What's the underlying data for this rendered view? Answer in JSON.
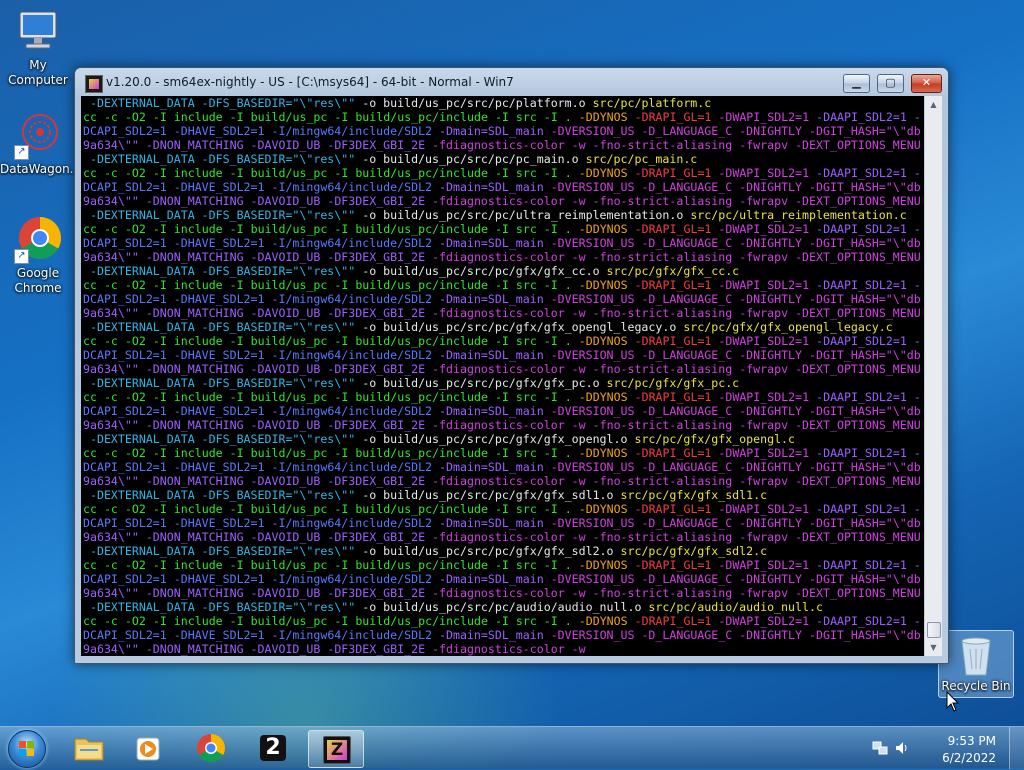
{
  "desktop": {
    "icons": [
      {
        "label": "My Computer"
      },
      {
        "label": "DataWagon..."
      },
      {
        "label": "Google Chrome"
      },
      {
        "label": "Recycle Bin"
      }
    ]
  },
  "window": {
    "title": "v1.20.0 - sm64ex-nightly - US - [C:\\msys64] - 64-bit - Normal - Win7",
    "buttons": {
      "minimize": "▁",
      "maximize": "▢",
      "close": "✕"
    }
  },
  "colors": {
    "green": "#2ee62e",
    "white": "#e8e8e8",
    "cyan": "#2fb5e8",
    "yellow": "#e8e33a",
    "orange": "#f0a020",
    "red": "#ef4040",
    "magenta": "#d040e0",
    "violet": "#9a60ff",
    "blue": "#5a78ff"
  },
  "console": {
    "lines": [
      " -DEXTERNAL_DATA -DFS_BASEDIR=\"\\\"res\\\"\" -o build/us_pc/src/pc/platform.o src/pc/platform.c",
      "cc -c -O2 -I include -I build/us_pc -I build/us_pc/include -I src -I . -DDYNOS -DRAPI_GL=1 -DWAPI_SDL2=1 -DAAPI_SDL2=1 -",
      "DCAPI_SDL2=1 -DHAVE_SDL2=1 -I/mingw64/include/SDL2 -Dmain=SDL_main -DVERSION_US -D_LANGUAGE_C -DNIGHTLY -DGIT_HASH=\"\\\"db",
      "9a634\\\"\" -DNON_MATCHING -DAVOID_UB -DF3DEX_GBI_2E -fdiagnostics-color -w -fno-strict-aliasing -fwrapv -DEXT_OPTIONS_MENU",
      " -DEXTERNAL_DATA -DFS_BASEDIR=\"\\\"res\\\"\" -o build/us_pc/src/pc/pc_main.o src/pc/pc_main.c",
      "cc -c -O2 -I include -I build/us_pc -I build/us_pc/include -I src -I . -DDYNOS -DRAPI_GL=1 -DWAPI_SDL2=1 -DAAPI_SDL2=1 -",
      "DCAPI_SDL2=1 -DHAVE_SDL2=1 -I/mingw64/include/SDL2 -Dmain=SDL_main -DVERSION_US -D_LANGUAGE_C -DNIGHTLY -DGIT_HASH=\"\\\"db",
      "9a634\\\"\" -DNON_MATCHING -DAVOID_UB -DF3DEX_GBI_2E -fdiagnostics-color -w -fno-strict-aliasing -fwrapv -DEXT_OPTIONS_MENU",
      " -DEXTERNAL_DATA -DFS_BASEDIR=\"\\\"res\\\"\" -o build/us_pc/src/pc/ultra_reimplementation.o src/pc/ultra_reimplementation.c",
      "cc -c -O2 -I include -I build/us_pc -I build/us_pc/include -I src -I . -DDYNOS -DRAPI_GL=1 -DWAPI_SDL2=1 -DAAPI_SDL2=1 -",
      "DCAPI_SDL2=1 -DHAVE_SDL2=1 -I/mingw64/include/SDL2 -Dmain=SDL_main -DVERSION_US -D_LANGUAGE_C -DNIGHTLY -DGIT_HASH=\"\\\"db",
      "9a634\\\"\" -DNON_MATCHING -DAVOID_UB -DF3DEX_GBI_2E -fdiagnostics-color -w -fno-strict-aliasing -fwrapv -DEXT_OPTIONS_MENU",
      " -DEXTERNAL_DATA -DFS_BASEDIR=\"\\\"res\\\"\" -o build/us_pc/src/pc/gfx/gfx_cc.o src/pc/gfx/gfx_cc.c",
      "cc -c -O2 -I include -I build/us_pc -I build/us_pc/include -I src -I . -DDYNOS -DRAPI_GL=1 -DWAPI_SDL2=1 -DAAPI_SDL2=1 -",
      "DCAPI_SDL2=1 -DHAVE_SDL2=1 -I/mingw64/include/SDL2 -Dmain=SDL_main -DVERSION_US -D_LANGUAGE_C -DNIGHTLY -DGIT_HASH=\"\\\"db",
      "9a634\\\"\" -DNON_MATCHING -DAVOID_UB -DF3DEX_GBI_2E -fdiagnostics-color -w -fno-strict-aliasing -fwrapv -DEXT_OPTIONS_MENU",
      " -DEXTERNAL_DATA -DFS_BASEDIR=\"\\\"res\\\"\" -o build/us_pc/src/pc/gfx/gfx_opengl_legacy.o src/pc/gfx/gfx_opengl_legacy.c",
      "cc -c -O2 -I include -I build/us_pc -I build/us_pc/include -I src -I . -DDYNOS -DRAPI_GL=1 -DWAPI_SDL2=1 -DAAPI_SDL2=1 -",
      "DCAPI_SDL2=1 -DHAVE_SDL2=1 -I/mingw64/include/SDL2 -Dmain=SDL_main -DVERSION_US -D_LANGUAGE_C -DNIGHTLY -DGIT_HASH=\"\\\"db",
      "9a634\\\"\" -DNON_MATCHING -DAVOID_UB -DF3DEX_GBI_2E -fdiagnostics-color -w -fno-strict-aliasing -fwrapv -DEXT_OPTIONS_MENU",
      " -DEXTERNAL_DATA -DFS_BASEDIR=\"\\\"res\\\"\" -o build/us_pc/src/pc/gfx/gfx_pc.o src/pc/gfx/gfx_pc.c",
      "cc -c -O2 -I include -I build/us_pc -I build/us_pc/include -I src -I . -DDYNOS -DRAPI_GL=1 -DWAPI_SDL2=1 -DAAPI_SDL2=1 -",
      "DCAPI_SDL2=1 -DHAVE_SDL2=1 -I/mingw64/include/SDL2 -Dmain=SDL_main -DVERSION_US -D_LANGUAGE_C -DNIGHTLY -DGIT_HASH=\"\\\"db",
      "9a634\\\"\" -DNON_MATCHING -DAVOID_UB -DF3DEX_GBI_2E -fdiagnostics-color -w -fno-strict-aliasing -fwrapv -DEXT_OPTIONS_MENU",
      " -DEXTERNAL_DATA -DFS_BASEDIR=\"\\\"res\\\"\" -o build/us_pc/src/pc/gfx/gfx_opengl.o src/pc/gfx/gfx_opengl.c",
      "cc -c -O2 -I include -I build/us_pc -I build/us_pc/include -I src -I . -DDYNOS -DRAPI_GL=1 -DWAPI_SDL2=1 -DAAPI_SDL2=1 -",
      "DCAPI_SDL2=1 -DHAVE_SDL2=1 -I/mingw64/include/SDL2 -Dmain=SDL_main -DVERSION_US -D_LANGUAGE_C -DNIGHTLY -DGIT_HASH=\"\\\"db",
      "9a634\\\"\" -DNON_MATCHING -DAVOID_UB -DF3DEX_GBI_2E -fdiagnostics-color -w -fno-strict-aliasing -fwrapv -DEXT_OPTIONS_MENU",
      " -DEXTERNAL_DATA -DFS_BASEDIR=\"\\\"res\\\"\" -o build/us_pc/src/pc/gfx/gfx_sdl1.o src/pc/gfx/gfx_sdl1.c",
      "cc -c -O2 -I include -I build/us_pc -I build/us_pc/include -I src -I . -DDYNOS -DRAPI_GL=1 -DWAPI_SDL2=1 -DAAPI_SDL2=1 -",
      "DCAPI_SDL2=1 -DHAVE_SDL2=1 -I/mingw64/include/SDL2 -Dmain=SDL_main -DVERSION_US -D_LANGUAGE_C -DNIGHTLY -DGIT_HASH=\"\\\"db",
      "9a634\\\"\" -DNON_MATCHING -DAVOID_UB -DF3DEX_GBI_2E -fdiagnostics-color -w -fno-strict-aliasing -fwrapv -DEXT_OPTIONS_MENU",
      " -DEXTERNAL_DATA -DFS_BASEDIR=\"\\\"res\\\"\" -o build/us_pc/src/pc/gfx/gfx_sdl2.o src/pc/gfx/gfx_sdl2.c",
      "cc -c -O2 -I include -I build/us_pc -I build/us_pc/include -I src -I . -DDYNOS -DRAPI_GL=1 -DWAPI_SDL2=1 -DAAPI_SDL2=1 -",
      "DCAPI_SDL2=1 -DHAVE_SDL2=1 -I/mingw64/include/SDL2 -Dmain=SDL_main -DVERSION_US -D_LANGUAGE_C -DNIGHTLY -DGIT_HASH=\"\\\"db",
      "9a634\\\"\" -DNON_MATCHING -DAVOID_UB -DF3DEX_GBI_2E -fdiagnostics-color -w -fno-strict-aliasing -fwrapv -DEXT_OPTIONS_MENU",
      " -DEXTERNAL_DATA -DFS_BASEDIR=\"\\\"res\\\"\" -o build/us_pc/src/pc/audio/audio_null.o src/pc/audio/audio_null.c",
      "cc -c -O2 -I include -I build/us_pc -I build/us_pc/include -I src -I . -DDYNOS -DRAPI_GL=1 -DWAPI_SDL2=1 -DAAPI_SDL2=1 -",
      "DCAPI_SDL2=1 -DHAVE_SDL2=1 -I/mingw64/include/SDL2 -Dmain=SDL_main -DVERSION_US -D_LANGUAGE_C -DNIGHTLY -DGIT_HASH=\"\\\"db",
      "9a634\\\"\" -DNON_MATCHING -DAVOID_UB -DF3DEX_GBI_2E -fdiagnostics-color -w"
    ]
  },
  "taskbar": {
    "items": [
      {
        "name": "windows-explorer",
        "icon": "folder-icon"
      },
      {
        "name": "media-player",
        "icon": "media-icon"
      },
      {
        "name": "google-chrome",
        "icon": "chrome-icon"
      },
      {
        "name": "app-2",
        "icon": "two-icon",
        "glyph": "2"
      },
      {
        "name": "sm64ex-console",
        "icon": "z-icon",
        "glyph": "Z"
      }
    ],
    "clock": {
      "time": "9:53 PM",
      "date": "6/2/2022"
    }
  }
}
